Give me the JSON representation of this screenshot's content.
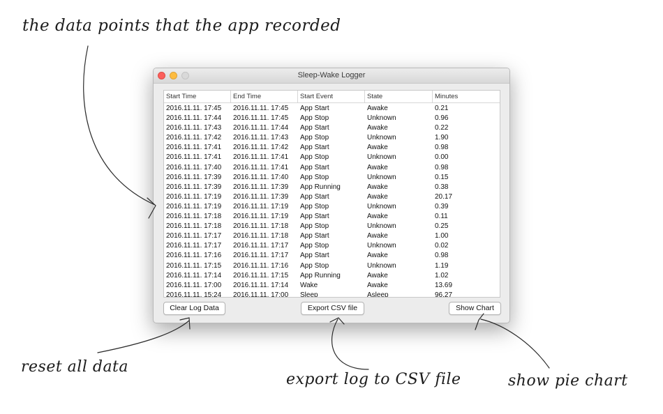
{
  "annotations": {
    "top": "the data points that the app recorded",
    "reset": "reset all data",
    "export": "export log to CSV file",
    "chart": "show pie chart"
  },
  "window": {
    "title": "Sleep-Wake Logger",
    "controls": [
      "close",
      "minimize",
      "zoom"
    ]
  },
  "table": {
    "columns": [
      "Start Time",
      "End Time",
      "Start Event",
      "State",
      "Minutes"
    ],
    "rows": [
      [
        "2016.11.11. 17:45",
        "2016.11.11. 17:45",
        "App Start",
        "Awake",
        "0.21"
      ],
      [
        "2016.11.11. 17:44",
        "2016.11.11. 17:45",
        "App Stop",
        "Unknown",
        "0.96"
      ],
      [
        "2016.11.11. 17:43",
        "2016.11.11. 17:44",
        "App Start",
        "Awake",
        "0.22"
      ],
      [
        "2016.11.11. 17:42",
        "2016.11.11. 17:43",
        "App Stop",
        "Unknown",
        "1.90"
      ],
      [
        "2016.11.11. 17:41",
        "2016.11.11. 17:42",
        "App Start",
        "Awake",
        "0.98"
      ],
      [
        "2016.11.11. 17:41",
        "2016.11.11. 17:41",
        "App Stop",
        "Unknown",
        "0.00"
      ],
      [
        "2016.11.11. 17:40",
        "2016.11.11. 17:41",
        "App Start",
        "Awake",
        "0.98"
      ],
      [
        "2016.11.11. 17:39",
        "2016.11.11. 17:40",
        "App Stop",
        "Unknown",
        "0.15"
      ],
      [
        "2016.11.11. 17:39",
        "2016.11.11. 17:39",
        "App Running",
        "Awake",
        "0.38"
      ],
      [
        "2016.11.11. 17:19",
        "2016.11.11. 17:39",
        "App Start",
        "Awake",
        "20.17"
      ],
      [
        "2016.11.11. 17:19",
        "2016.11.11. 17:19",
        "App Stop",
        "Unknown",
        "0.39"
      ],
      [
        "2016.11.11. 17:18",
        "2016.11.11. 17:19",
        "App Start",
        "Awake",
        "0.11"
      ],
      [
        "2016.11.11. 17:18",
        "2016.11.11. 17:18",
        "App Stop",
        "Unknown",
        "0.25"
      ],
      [
        "2016.11.11. 17:17",
        "2016.11.11. 17:18",
        "App Start",
        "Awake",
        "1.00"
      ],
      [
        "2016.11.11. 17:17",
        "2016.11.11. 17:17",
        "App Stop",
        "Unknown",
        "0.02"
      ],
      [
        "2016.11.11. 17:16",
        "2016.11.11. 17:17",
        "App Start",
        "Awake",
        "0.98"
      ],
      [
        "2016.11.11. 17:15",
        "2016.11.11. 17:16",
        "App Stop",
        "Unknown",
        "1.19"
      ],
      [
        "2016.11.11. 17:14",
        "2016.11.11. 17:15",
        "App Running",
        "Awake",
        "1.02"
      ],
      [
        "2016.11.11. 17:00",
        "2016.11.11. 17:14",
        "Wake",
        "Awake",
        "13.69"
      ],
      [
        "2016.11.11. 15:24",
        "2016.11.11. 17:00",
        "Sleep",
        "Asleep",
        "96.27"
      ]
    ]
  },
  "buttons": {
    "clear": "Clear Log Data",
    "export": "Export CSV file",
    "chart": "Show Chart"
  },
  "colors": {
    "close": "#fc605c",
    "minimize": "#fdbc40",
    "zoom": "#d9d9d9",
    "window_bg": "#ececec"
  }
}
